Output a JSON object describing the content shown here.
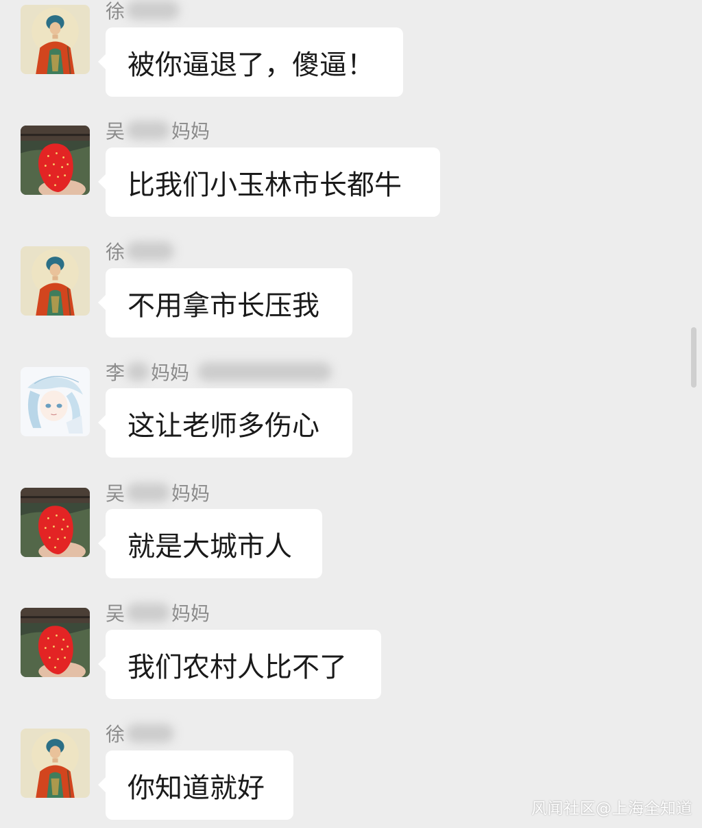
{
  "messages": [
    {
      "sender": {
        "prefix": "徐",
        "suffix": ""
      },
      "avatar": "buddhist-monk-painting",
      "text": "被你逼退了，傻逼！"
    },
    {
      "sender": {
        "prefix": "吴",
        "suffix": "妈妈"
      },
      "avatar": "strawberry-photo",
      "text": "比我们小玉林市长都牛"
    },
    {
      "sender": {
        "prefix": "徐",
        "suffix": ""
      },
      "avatar": "buddhist-monk-painting",
      "text": "不用拿市长压我"
    },
    {
      "sender": {
        "prefix": "李",
        "suffix": "妈妈"
      },
      "avatar": "anime-girl-illustration",
      "text": "这让老师多伤心"
    },
    {
      "sender": {
        "prefix": "吴",
        "suffix": "妈妈"
      },
      "avatar": "strawberry-photo",
      "text": "就是大城市人"
    },
    {
      "sender": {
        "prefix": "吴",
        "suffix": "妈妈"
      },
      "avatar": "strawberry-photo",
      "text": "我们农村人比不了"
    },
    {
      "sender": {
        "prefix": "徐",
        "suffix": ""
      },
      "avatar": "buddhist-monk-painting",
      "text": "你知道就好"
    }
  ],
  "watermark": "风闻社区@上海全知道",
  "colors": {
    "background": "#ededed",
    "bubble": "#ffffff",
    "sender_text": "#8a8a8a",
    "message_text": "#1a1a1a"
  }
}
